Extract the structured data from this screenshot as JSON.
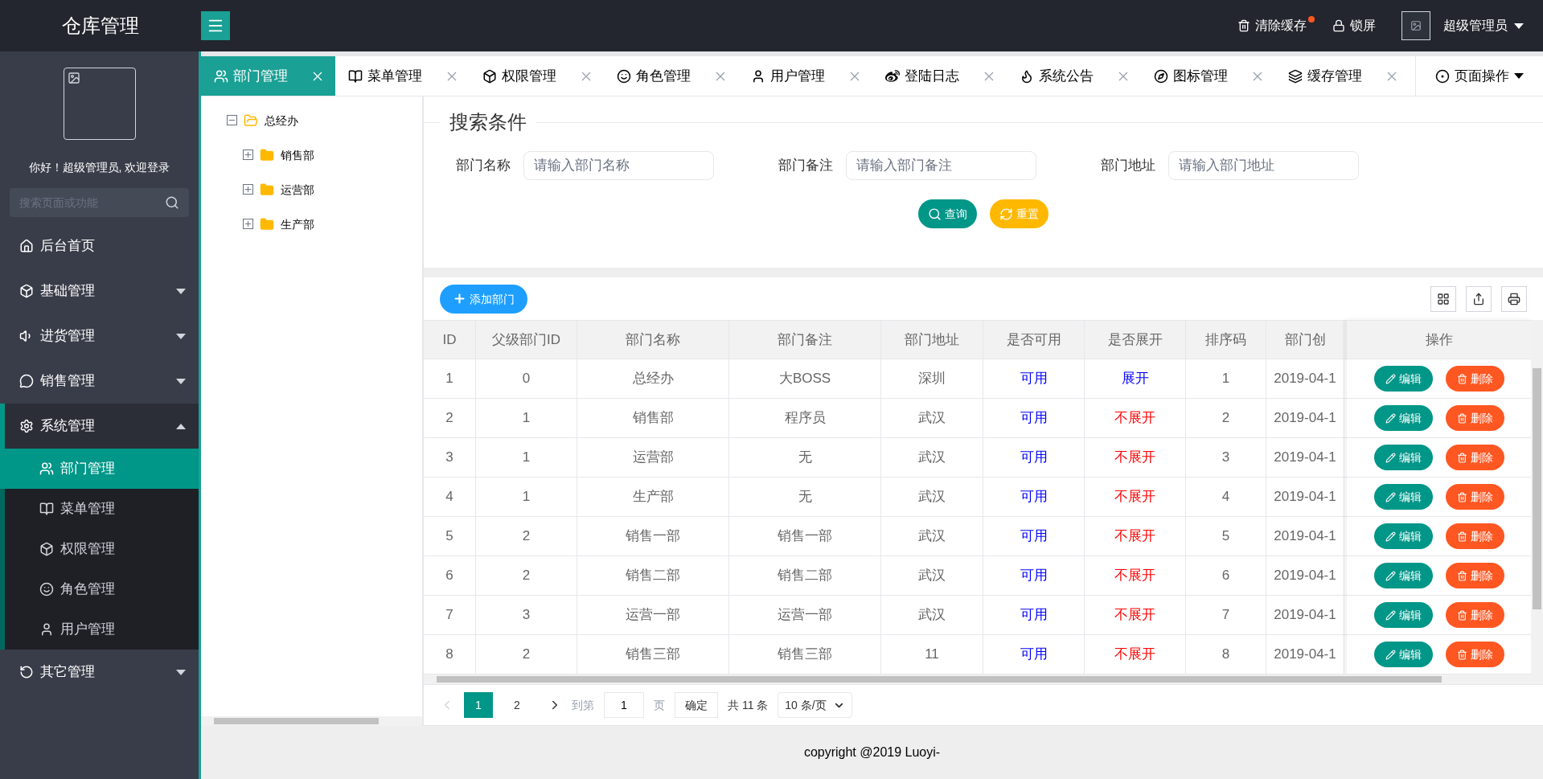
{
  "app": {
    "title": "仓库管理"
  },
  "header": {
    "actions": [
      {
        "label": "清除缓存",
        "badge": true
      },
      {
        "label": "锁屏",
        "badge": false
      }
    ],
    "user": {
      "name": "超级管理员"
    }
  },
  "sidebar": {
    "greeting": "你好！超级管理员, 欢迎登录",
    "search": {
      "placeholder": "搜索页面或功能"
    },
    "items": [
      {
        "kind": "link",
        "label": "后台首页"
      },
      {
        "kind": "group",
        "label": "基础管理",
        "expanded": false
      },
      {
        "kind": "group",
        "label": "进货管理",
        "expanded": false
      },
      {
        "kind": "group",
        "label": "销售管理",
        "expanded": false
      },
      {
        "kind": "group",
        "label": "系统管理",
        "expanded": true,
        "children": [
          {
            "label": "部门管理",
            "selected": true
          },
          {
            "label": "菜单管理",
            "selected": false
          },
          {
            "label": "权限管理",
            "selected": false
          },
          {
            "label": "角色管理",
            "selected": false
          },
          {
            "label": "用户管理",
            "selected": false
          }
        ]
      },
      {
        "kind": "group",
        "label": "其它管理",
        "expanded": false
      }
    ]
  },
  "tabs": [
    {
      "label": "部门管理",
      "selected": true
    },
    {
      "label": "菜单管理",
      "selected": false
    },
    {
      "label": "权限管理",
      "selected": false
    },
    {
      "label": "角色管理",
      "selected": false
    },
    {
      "label": "用户管理",
      "selected": false
    },
    {
      "label": "登陆日志",
      "selected": false
    },
    {
      "label": "系统公告",
      "selected": false
    },
    {
      "label": "图标管理",
      "selected": false
    },
    {
      "label": "缓存管理",
      "selected": false
    }
  ],
  "page_actions": {
    "label": "页面操作"
  },
  "tree": [
    {
      "label": "总经办",
      "expanded": true,
      "children": [
        {
          "label": "销售部",
          "expanded": false
        },
        {
          "label": "运营部",
          "expanded": false
        },
        {
          "label": "生产部",
          "expanded": false
        }
      ]
    }
  ],
  "search": {
    "legend": "搜索条件",
    "fields": [
      {
        "label": "部门名称",
        "placeholder": "请输入部门名称"
      },
      {
        "label": "部门备注",
        "placeholder": "请输入部门备注"
      },
      {
        "label": "部门地址",
        "placeholder": "请输入部门地址"
      }
    ],
    "buttons": [
      {
        "label": "查询",
        "kind": "search"
      },
      {
        "label": "重置",
        "kind": "reset"
      }
    ]
  },
  "toolbar": {
    "add_label": "添加部门"
  },
  "table": {
    "columns": [
      "ID",
      "父级部门ID",
      "部门名称",
      "部门备注",
      "部门地址",
      "是否可用",
      "是否展开",
      "排序码",
      "部门创"
    ],
    "action_column": "操作",
    "rows": [
      {
        "cells": [
          "1",
          "0",
          "总经办",
          "大BOSS",
          "深圳",
          "可用",
          "展开",
          "1",
          "2019-04-1"
        ],
        "expanded": true,
        "actions": [
          "编辑",
          "删除"
        ]
      },
      {
        "cells": [
          "2",
          "1",
          "销售部",
          "程序员",
          "武汉",
          "可用",
          "不展开",
          "2",
          "2019-04-1"
        ],
        "expanded": false,
        "actions": [
          "编辑",
          "删除"
        ]
      },
      {
        "cells": [
          "3",
          "1",
          "运营部",
          "无",
          "武汉",
          "可用",
          "不展开",
          "3",
          "2019-04-1"
        ],
        "expanded": false,
        "actions": [
          "编辑",
          "删除"
        ]
      },
      {
        "cells": [
          "4",
          "1",
          "生产部",
          "无",
          "武汉",
          "可用",
          "不展开",
          "4",
          "2019-04-1"
        ],
        "expanded": false,
        "actions": [
          "编辑",
          "删除"
        ]
      },
      {
        "cells": [
          "5",
          "2",
          "销售一部",
          "销售一部",
          "武汉",
          "可用",
          "不展开",
          "5",
          "2019-04-1"
        ],
        "expanded": false,
        "actions": [
          "编辑",
          "删除"
        ]
      },
      {
        "cells": [
          "6",
          "2",
          "销售二部",
          "销售二部",
          "武汉",
          "可用",
          "不展开",
          "6",
          "2019-04-1"
        ],
        "expanded": false,
        "actions": [
          "编辑",
          "删除"
        ]
      },
      {
        "cells": [
          "7",
          "3",
          "运营一部",
          "运营一部",
          "武汉",
          "可用",
          "不展开",
          "7",
          "2019-04-1"
        ],
        "expanded": false,
        "actions": [
          "编辑",
          "删除"
        ]
      },
      {
        "cells": [
          "8",
          "2",
          "销售三部",
          "销售三部",
          "11",
          "可用",
          "不展开",
          "8",
          "2019-04-1"
        ],
        "expanded": false,
        "actions": [
          "编辑",
          "删除"
        ]
      }
    ]
  },
  "pagination": {
    "pages": [
      {
        "label": "1",
        "selected": true
      },
      {
        "label": "2",
        "selected": false
      }
    ],
    "goto_label": "到第",
    "goto_value": "1",
    "page_unit": "页",
    "confirm": "确定",
    "total": "共 11 条",
    "page_size": "10 条/页"
  },
  "footer": {
    "text": "copyright @2019 Luoyi-"
  }
}
